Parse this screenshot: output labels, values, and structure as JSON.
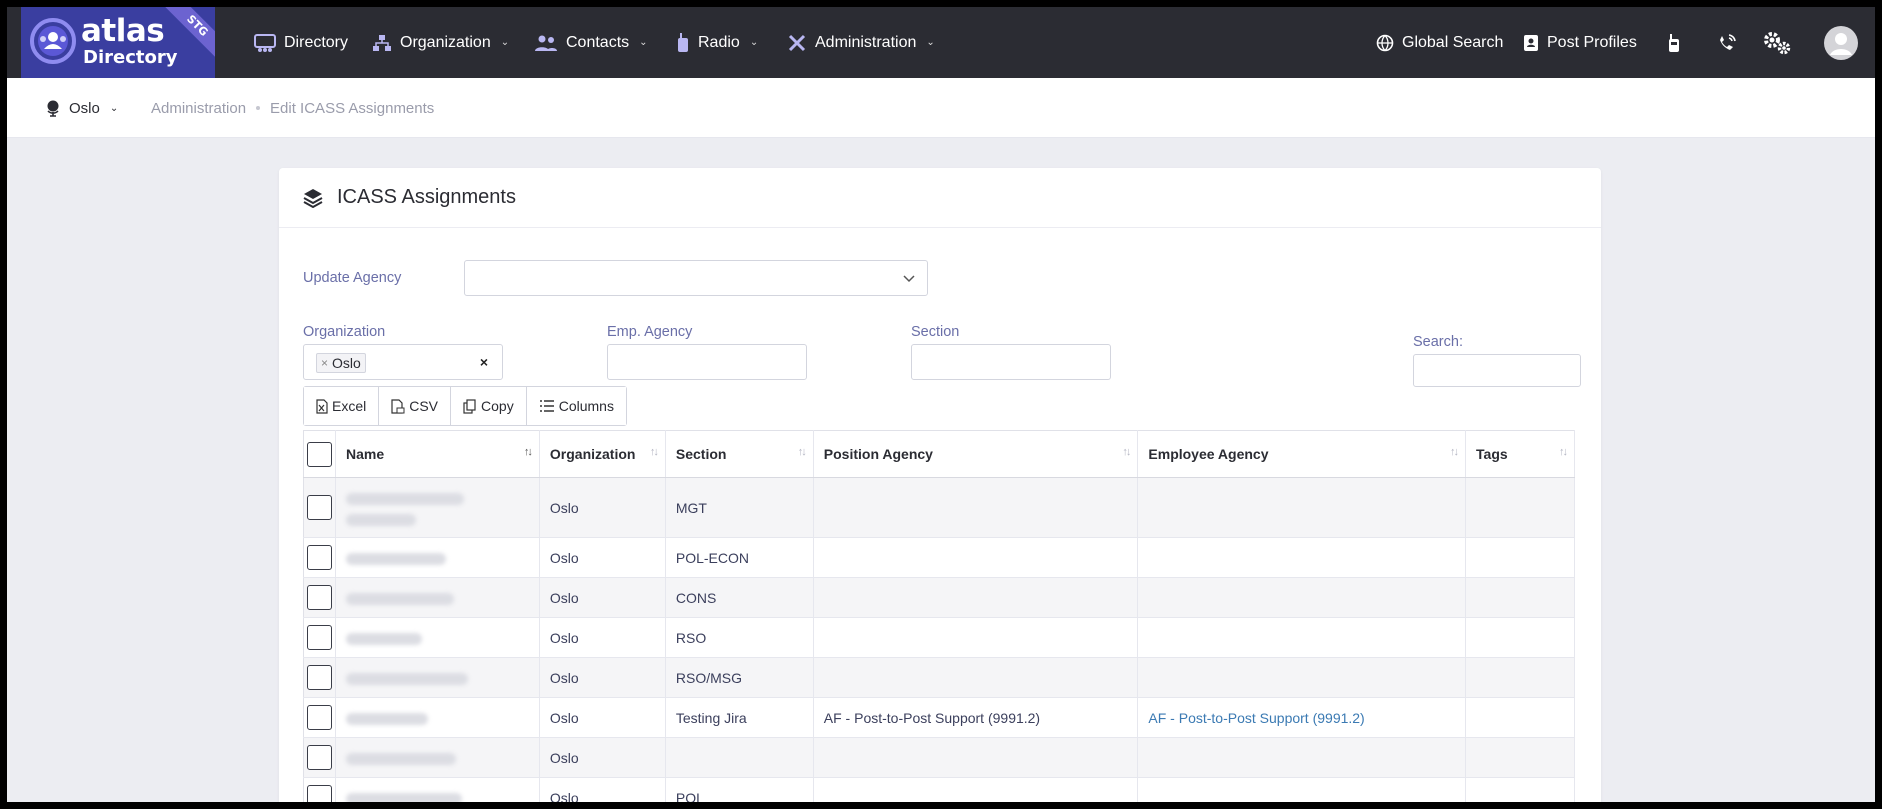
{
  "app": {
    "logo_line1": "atlas",
    "logo_line2": "Directory",
    "env_badge": "STG"
  },
  "nav": {
    "items": [
      {
        "label": "Directory",
        "icon": "directory-icon",
        "dropdown": false
      },
      {
        "label": "Organization",
        "icon": "org-chart-icon",
        "dropdown": true
      },
      {
        "label": "Contacts",
        "icon": "contacts-icon",
        "dropdown": true
      },
      {
        "label": "Radio",
        "icon": "radio-icon",
        "dropdown": true
      },
      {
        "label": "Administration",
        "icon": "tools-icon",
        "dropdown": true
      }
    ],
    "right": [
      {
        "label": "Global Search",
        "icon": "globe-icon"
      },
      {
        "label": "Post Profiles",
        "icon": "book-icon"
      }
    ]
  },
  "subbar": {
    "post": "Oslo",
    "breadcrumb": [
      "Administration",
      "Edit ICASS Assignments"
    ]
  },
  "card": {
    "title": "ICASS Assignments",
    "update_agency_label": "Update Agency",
    "organization_label": "Organization",
    "organization_value": "Oslo",
    "emp_agency_label": "Emp. Agency",
    "section_label": "Section",
    "search_label": "Search:",
    "buttons": {
      "excel": "Excel",
      "csv": "CSV",
      "copy": "Copy",
      "columns": "Columns"
    }
  },
  "table": {
    "headers": {
      "name": "Name",
      "organization": "Organization",
      "section": "Section",
      "position_agency": "Position Agency",
      "employee_agency": "Employee Agency",
      "tags": "Tags"
    },
    "rows": [
      {
        "organization": "Oslo",
        "section": "MGT",
        "position_agency": "",
        "employee_agency": ""
      },
      {
        "organization": "Oslo",
        "section": "POL-ECON",
        "position_agency": "",
        "employee_agency": ""
      },
      {
        "organization": "Oslo",
        "section": "CONS",
        "position_agency": "",
        "employee_agency": ""
      },
      {
        "organization": "Oslo",
        "section": "RSO",
        "position_agency": "",
        "employee_agency": ""
      },
      {
        "organization": "Oslo",
        "section": "RSO/MSG",
        "position_agency": "",
        "employee_agency": ""
      },
      {
        "organization": "Oslo",
        "section": "Testing Jira",
        "position_agency": "AF - Post-to-Post Support (9991.2)",
        "employee_agency": "AF - Post-to-Post Support (9991.2)"
      },
      {
        "organization": "Oslo",
        "section": "",
        "position_agency": "",
        "employee_agency": ""
      },
      {
        "organization": "Oslo",
        "section": "POL",
        "position_agency": "",
        "employee_agency": ""
      }
    ]
  },
  "colors": {
    "navbar": "#2b2c33",
    "logo_bg": "#3a3ea0",
    "label": "#6a6fa8",
    "link": "#3b7ab3"
  }
}
